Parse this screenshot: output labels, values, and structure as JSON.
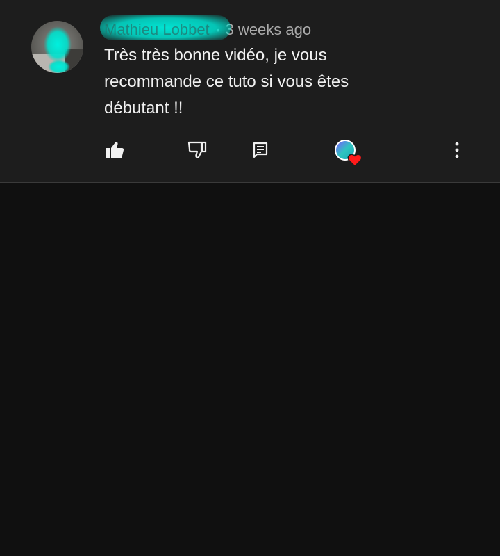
{
  "comment": {
    "author": "Mathieu Lobbet",
    "separator": "•",
    "time": "3 weeks ago",
    "text": "Très très bonne vidéo, je vous recommande ce tuto si vous êtes débutant !!"
  },
  "actions": {
    "like_icon": "thumb-up-filled-icon",
    "dislike_icon": "thumb-down-outline-icon",
    "reply_icon": "comment-reply-icon",
    "hearted_icon": "creator-heart-badge-icon",
    "more_icon": "more-vertical-icon"
  },
  "colors": {
    "background": "#101010",
    "comment_background": "#1d1d1d",
    "text": "#f1f1f1",
    "secondary_text": "#aaaaaa",
    "heart": "#ff1a1a",
    "redaction": "#00e6d2"
  }
}
